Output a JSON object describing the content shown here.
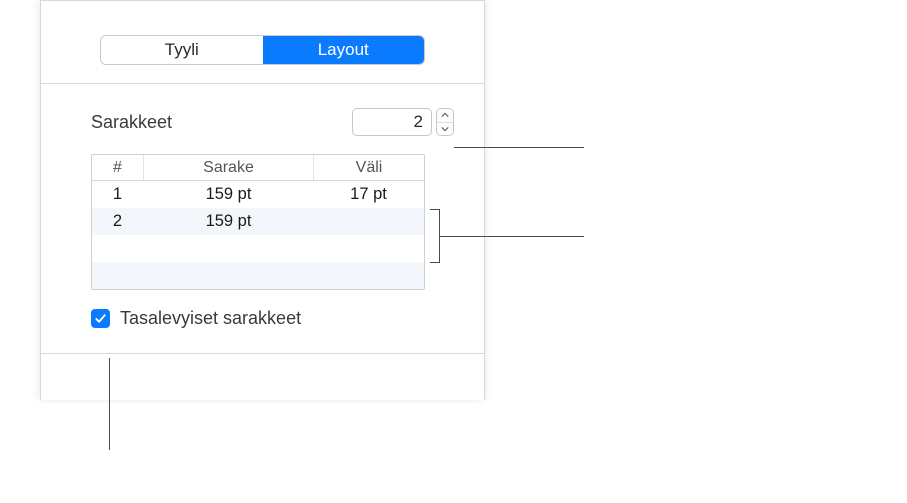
{
  "tabs": {
    "style": "Tyyli",
    "layout": "Layout"
  },
  "columns": {
    "label": "Sarakkeet",
    "value": "2"
  },
  "table": {
    "headers": {
      "num": "#",
      "sarake": "Sarake",
      "vali": "Väli"
    },
    "rows": [
      {
        "num": "1",
        "sarake": "159 pt",
        "vali": "17 pt"
      },
      {
        "num": "2",
        "sarake": "159 pt",
        "vali": ""
      }
    ]
  },
  "equalWidth": {
    "label": "Tasalevyiset sarakkeet",
    "checked": true
  }
}
